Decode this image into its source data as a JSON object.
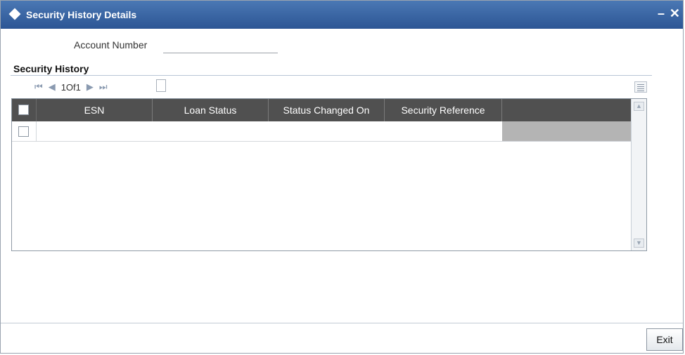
{
  "window": {
    "title": "Security History Details",
    "minimize_glyph": "–",
    "close_glyph": "✕",
    "title_icon": "diamond-icon"
  },
  "account": {
    "label": "Account Number",
    "value": ""
  },
  "section": {
    "title": "Security History"
  },
  "pager": {
    "first_glyph": "⏮",
    "prev_glyph": "◀",
    "count": "1Of1",
    "next_glyph": "▶",
    "last_glyph": "⏭"
  },
  "table": {
    "columns": [
      "ESN",
      "Loan Status",
      "Status Changed On",
      "Security Reference",
      ""
    ],
    "rows": [
      {
        "esn": "",
        "loan_status": "",
        "status_changed_on": "",
        "security_reference": ""
      }
    ]
  },
  "footer": {
    "exit_label": "Exit"
  },
  "colors": {
    "titlebar": "#2c5594",
    "header": "#505050",
    "row_gray_cell": "#b4b4b4"
  }
}
